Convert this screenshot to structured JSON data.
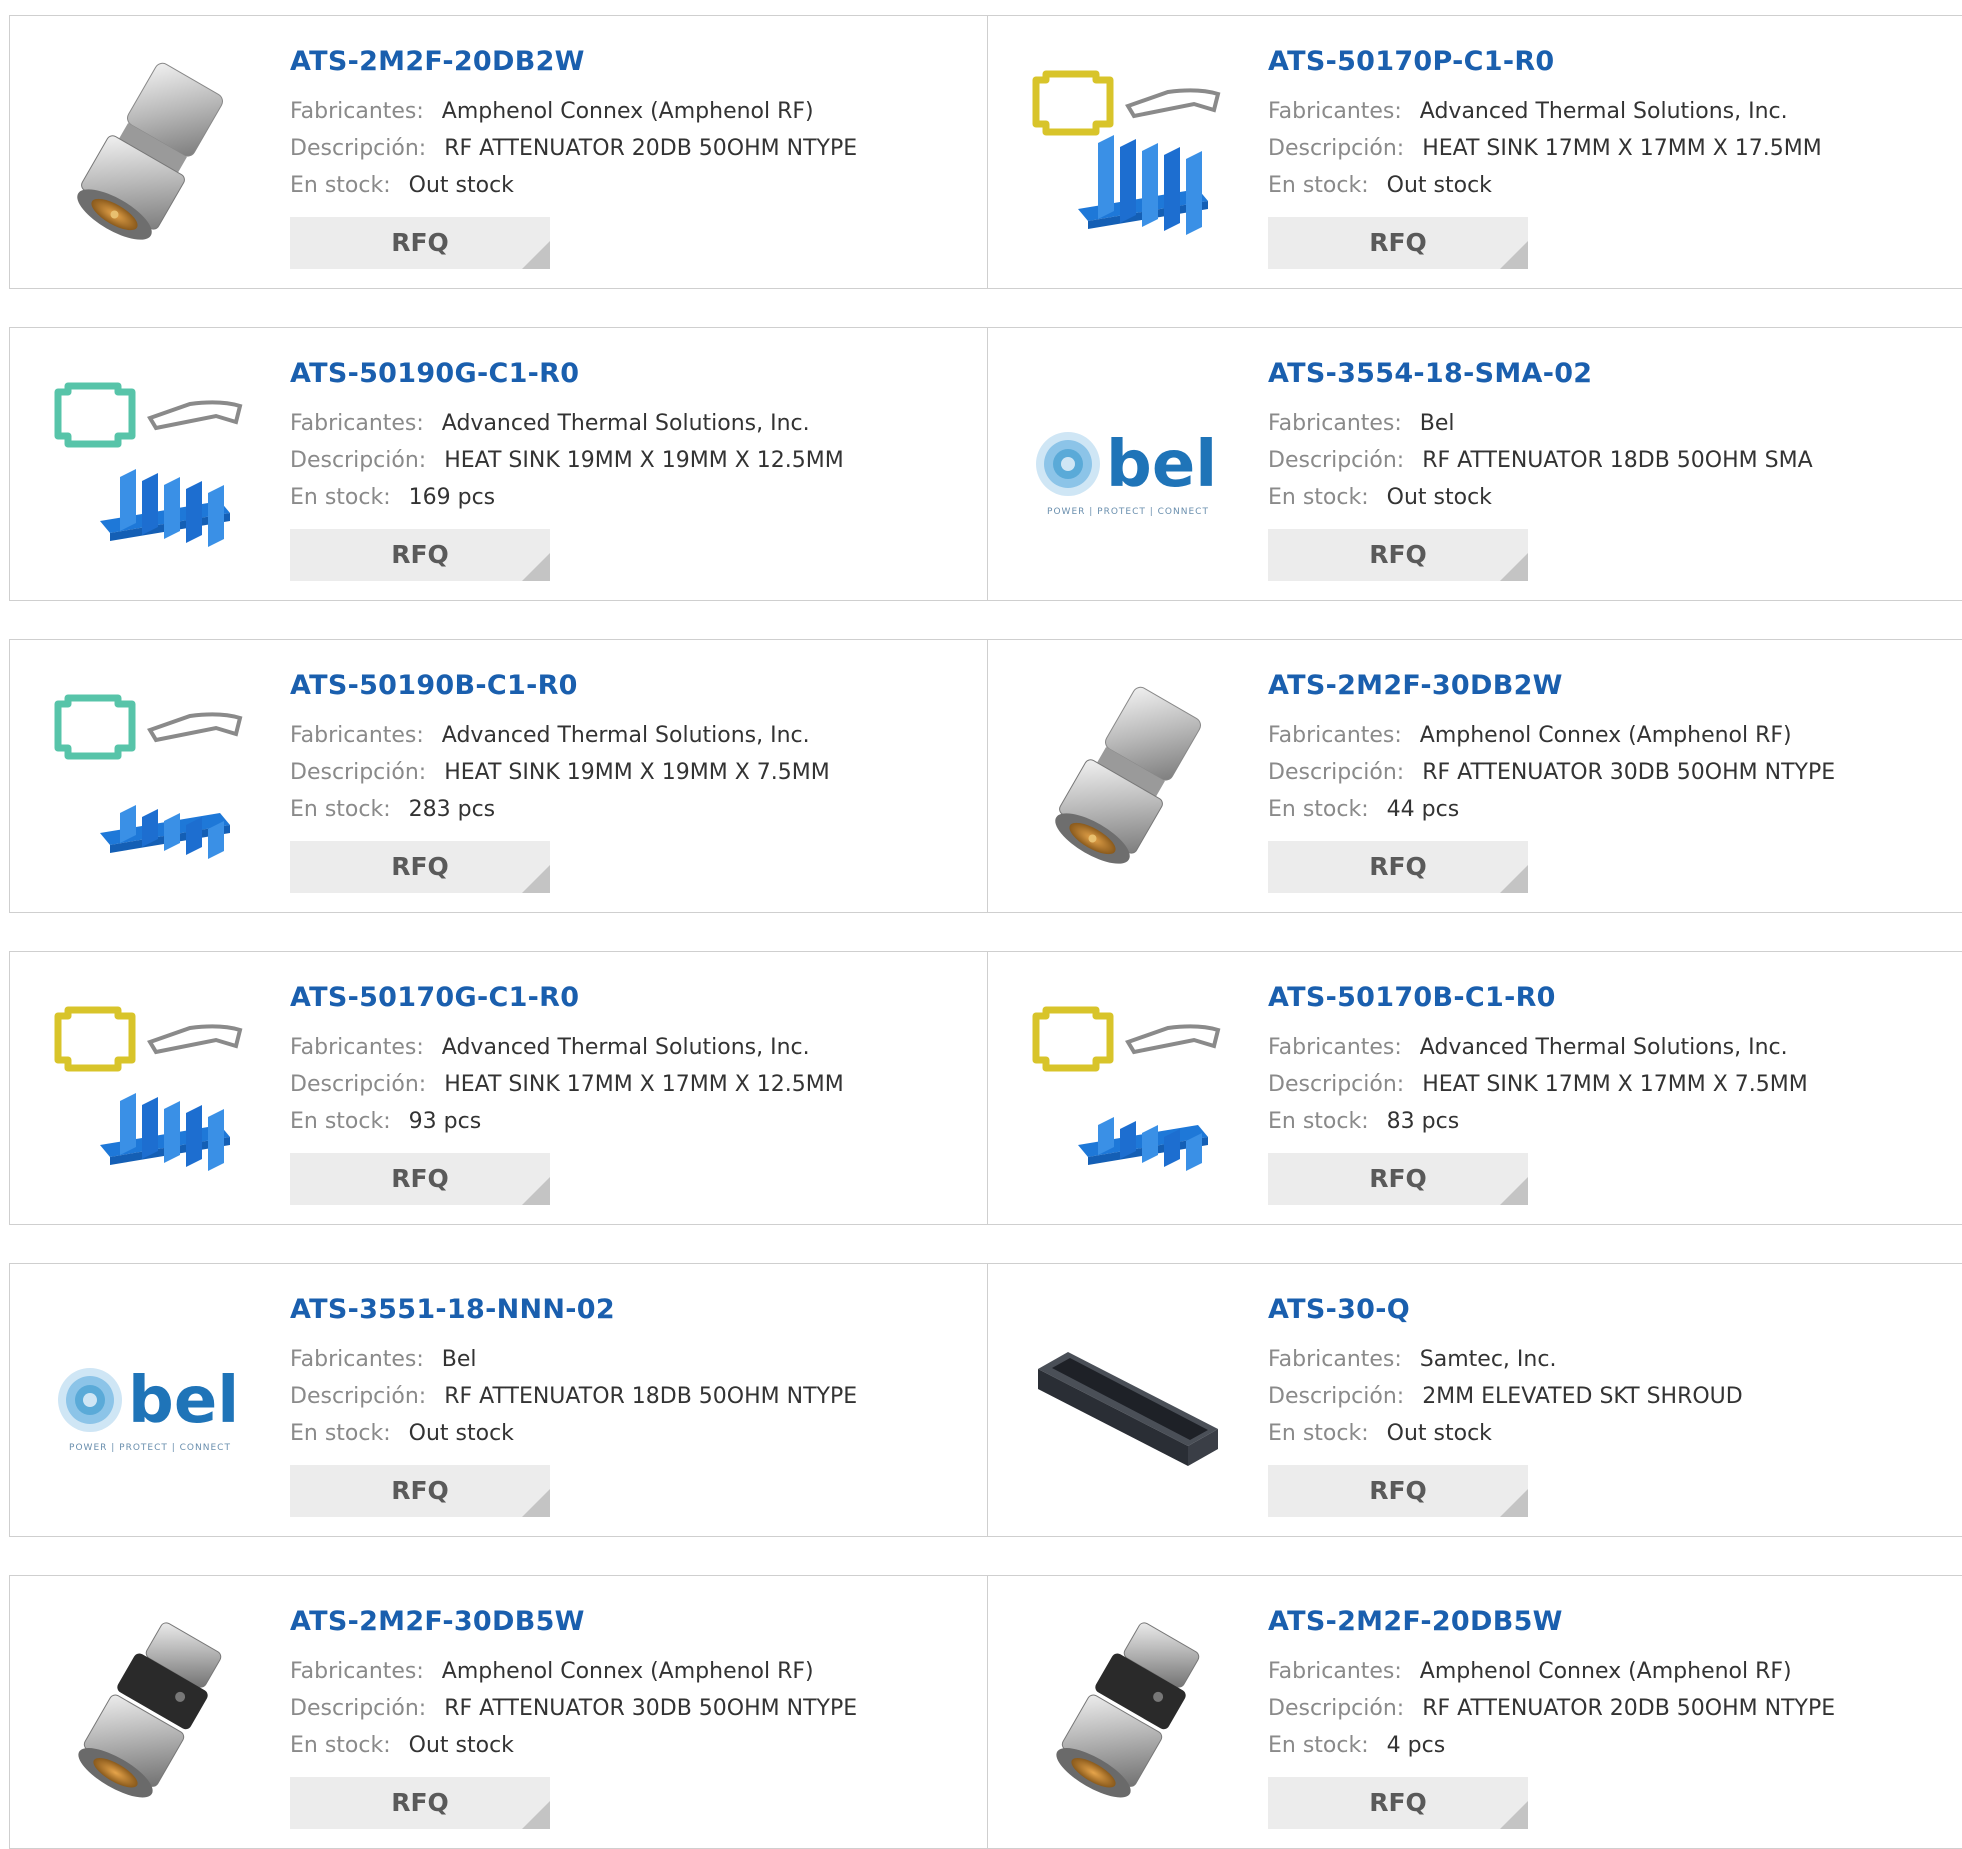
{
  "labels": {
    "manufacturer": "Fabricantes:",
    "description": "Descripción:",
    "stock": "En stock:",
    "rfq": "RFQ"
  },
  "products": [
    {
      "part": "ATS-2M2F-20DB2W",
      "manufacturer": "Amphenol Connex (Amphenol RF)",
      "description": "RF ATTENUATOR 20DB 50OHM NTYPE",
      "stock": "Out stock",
      "image": "n-connector-silver"
    },
    {
      "part": "ATS-50170P-C1-R0",
      "manufacturer": "Advanced Thermal Solutions, Inc.",
      "description": "HEAT SINK 17MM X 17MM X 17.5MM",
      "stock": "Out stock",
      "image": "heatsink-yellow-tall"
    },
    {
      "part": "ATS-50190G-C1-R0",
      "manufacturer": "Advanced Thermal Solutions, Inc.",
      "description": "HEAT SINK 19MM X 19MM X 12.5MM",
      "stock": "169 pcs",
      "image": "heatsink-teal-medium"
    },
    {
      "part": "ATS-3554-18-SMA-02",
      "manufacturer": "Bel",
      "description": "RF ATTENUATOR 18DB 50OHM SMA",
      "stock": "Out stock",
      "image": "bel-logo"
    },
    {
      "part": "ATS-50190B-C1-R0",
      "manufacturer": "Advanced Thermal Solutions, Inc.",
      "description": "HEAT SINK 19MM X 19MM X 7.5MM",
      "stock": "283 pcs",
      "image": "heatsink-teal-short"
    },
    {
      "part": "ATS-2M2F-30DB2W",
      "manufacturer": "Amphenol Connex (Amphenol RF)",
      "description": "RF ATTENUATOR 30DB 50OHM NTYPE",
      "stock": "44 pcs",
      "image": "n-connector-silver"
    },
    {
      "part": "ATS-50170G-C1-R0",
      "manufacturer": "Advanced Thermal Solutions, Inc.",
      "description": "HEAT SINK 17MM X 17MM X 12.5MM",
      "stock": "93 pcs",
      "image": "heatsink-yellow-medium"
    },
    {
      "part": "ATS-50170B-C1-R0",
      "manufacturer": "Advanced Thermal Solutions, Inc.",
      "description": "HEAT SINK 17MM X 17MM X 7.5MM",
      "stock": "83 pcs",
      "image": "heatsink-yellow-short"
    },
    {
      "part": "ATS-3551-18-NNN-02",
      "manufacturer": "Bel",
      "description": "RF ATTENUATOR 18DB 50OHM NTYPE",
      "stock": "Out stock",
      "image": "bel-logo"
    },
    {
      "part": "ATS-30-Q",
      "manufacturer": "Samtec, Inc.",
      "description": "2MM ELEVATED SKT SHROUD",
      "stock": "Out stock",
      "image": "shroud-black"
    },
    {
      "part": "ATS-2M2F-30DB5W",
      "manufacturer": "Amphenol Connex (Amphenol RF)",
      "description": "RF ATTENUATOR 30DB 50OHM NTYPE",
      "stock": "Out stock",
      "image": "n-connector-black"
    },
    {
      "part": "ATS-2M2F-20DB5W",
      "manufacturer": "Amphenol Connex (Amphenol RF)",
      "description": "RF ATTENUATOR 20DB 50OHM NTYPE",
      "stock": "4 pcs",
      "image": "n-connector-black"
    }
  ]
}
